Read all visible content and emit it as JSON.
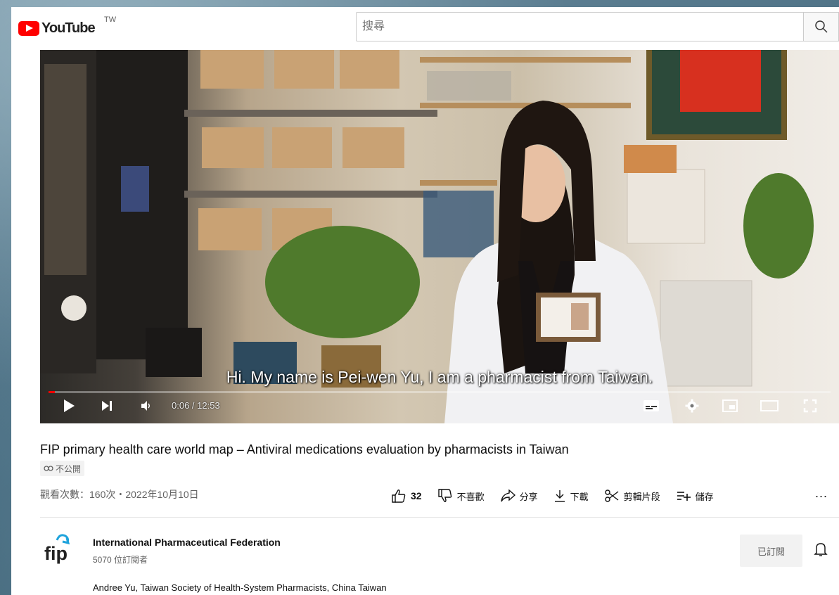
{
  "masthead": {
    "logo_text": "YouTube",
    "country_code": "TW",
    "search_placeholder": "搜尋"
  },
  "player": {
    "subtitle": "Hi. My name is Pei-wen Yu, I am a pharmacist from Taiwan.",
    "time_display": "0:06 / 12:53",
    "progress_fraction": 0.008,
    "icons": [
      "play-icon",
      "next-icon",
      "volume-icon",
      "subtitles-icon",
      "settings-icon",
      "miniplayer-icon",
      "theater-icon",
      "fullscreen-icon"
    ]
  },
  "video": {
    "title": "FIP primary health care world map – Antiviral medications evaluation by pharmacists in Taiwan",
    "privacy_label": "不公開",
    "views_and_date": "觀看次數：160次・2022年10月10日"
  },
  "actions": {
    "like_count": "32",
    "dislike_label": "不喜歡",
    "share_label": "分享",
    "download_label": "下載",
    "clip_label": "剪輯片段",
    "save_label": "儲存",
    "more_label": "..."
  },
  "channel": {
    "logo_text": "fip",
    "name": "International Pharmaceutical Federation",
    "subscribers": "5070 位訂閱者",
    "subscribed_label": "已訂閱"
  },
  "description": {
    "first_line": "Andree Yu, Taiwan Society of Health-System Pharmacists, China Taiwan"
  },
  "colors": {
    "brand_red": "#ff0000",
    "progress_red": "#ff0000",
    "fip_blue": "#1ea3dc"
  }
}
